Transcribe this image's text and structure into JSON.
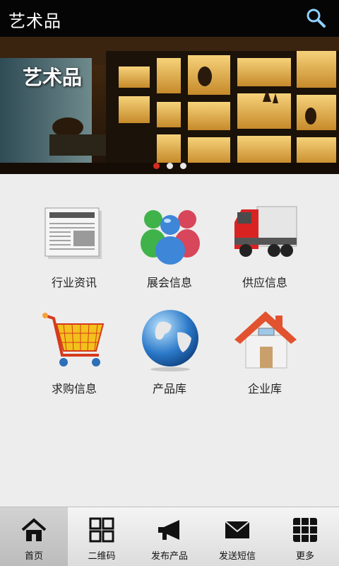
{
  "header": {
    "title": "艺术品",
    "search_icon": "search-icon"
  },
  "banner": {
    "caption": "艺术品",
    "slide_count": 3,
    "active_slide": 1
  },
  "grid": [
    {
      "label": "行业资讯",
      "icon": "newspaper-icon"
    },
    {
      "label": "展会信息",
      "icon": "people-group-icon"
    },
    {
      "label": "供应信息",
      "icon": "truck-icon"
    },
    {
      "label": "求购信息",
      "icon": "shopping-cart-icon"
    },
    {
      "label": "产品库",
      "icon": "globe-icon"
    },
    {
      "label": "企业库",
      "icon": "house-icon"
    }
  ],
  "nav": [
    {
      "label": "首页",
      "icon": "home-icon",
      "active": true
    },
    {
      "label": "二维码",
      "icon": "qr-code-icon",
      "active": false
    },
    {
      "label": "发布产品",
      "icon": "megaphone-icon",
      "active": false
    },
    {
      "label": "发送短信",
      "icon": "envelope-icon",
      "active": false
    },
    {
      "label": "更多",
      "icon": "grid-more-icon",
      "active": false
    }
  ],
  "colors": {
    "header_bg": "#050505",
    "page_bg": "#ececec",
    "dot_active": "#d72b1e"
  }
}
